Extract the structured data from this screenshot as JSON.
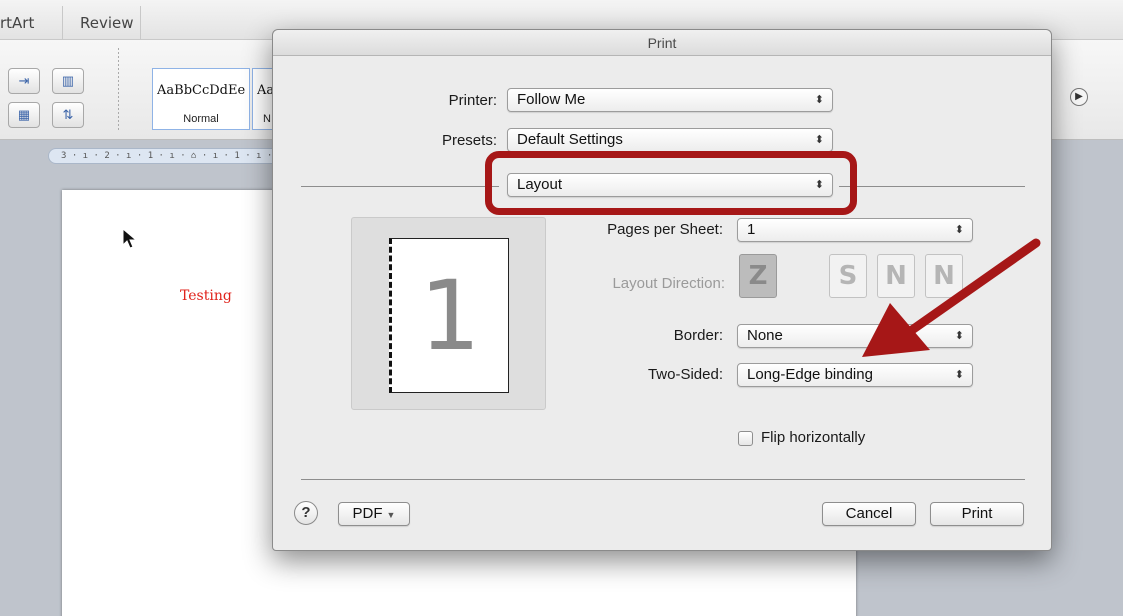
{
  "word": {
    "tabs": [
      "rtArt",
      "Review"
    ],
    "styles": [
      {
        "sample": "AaBbCcDdEe",
        "name": "Normal"
      },
      {
        "sample": "Aa",
        "name": "N"
      }
    ],
    "ruler_text": "3 · ı · 2 · ı · 1 · ı · ⌂ · ı · 1 · ı · 2 ·",
    "document_text": "Testing"
  },
  "dialog": {
    "title": "Print",
    "printer_label": "Printer:",
    "printer_value": "Follow Me",
    "presets_label": "Presets:",
    "presets_value": "Default Settings",
    "section_value": "Layout",
    "pages_per_sheet_label": "Pages per Sheet:",
    "pages_per_sheet_value": "1",
    "layout_direction_label": "Layout Direction:",
    "layout_directions": [
      "Z",
      "S",
      "N",
      "N"
    ],
    "border_label": "Border:",
    "border_value": "None",
    "two_sided_label": "Two-Sided:",
    "two_sided_value": "Long-Edge binding",
    "flip_label": "Flip horizontally",
    "flip_checked": false,
    "preview_page_number": "1",
    "help_label": "?",
    "pdf_label": "PDF",
    "cancel_label": "Cancel",
    "print_label": "Print"
  },
  "colors": {
    "annotation_red": "#a61717",
    "document_text": "#e0231b"
  }
}
